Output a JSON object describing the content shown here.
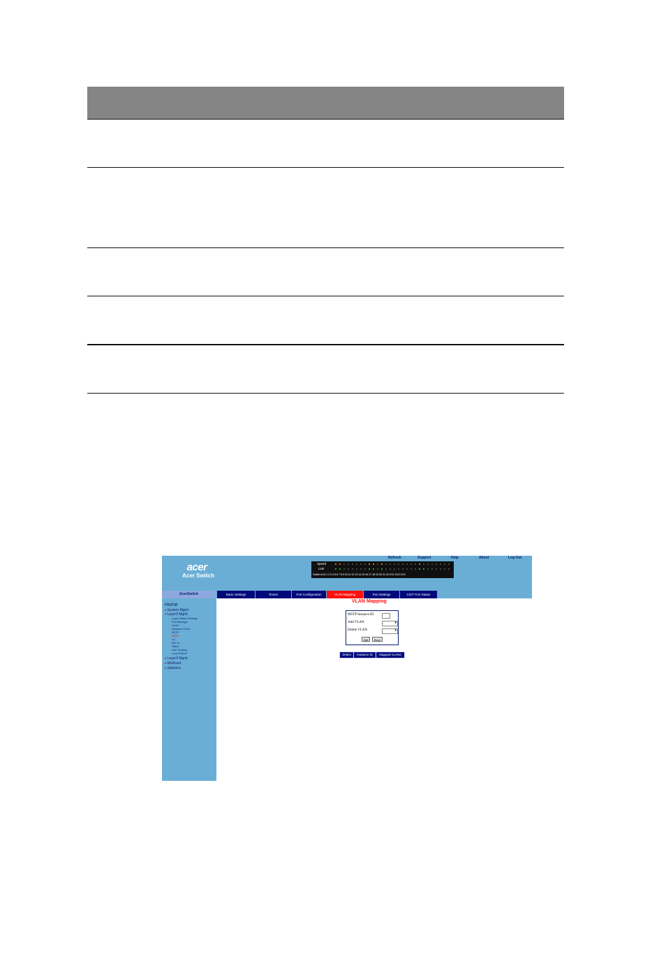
{
  "doc": {
    "separator_count": 6
  },
  "app": {
    "logo": "acer",
    "brand": "Acer Switch",
    "top_links": [
      "Refresh",
      "Support",
      "Help",
      "About",
      "Log Out"
    ],
    "panel": {
      "speed_label": "Speed",
      "link_label": "Link",
      "ports_label": "Switch 8-Gi 1 2 3 4 5 6 7 8 9 10 11 12 13 14 15 16 17 18 19 20 21 22 XX1 XX2 XX3"
    },
    "sidebar_header": "AcerSwitch",
    "tabs": [
      "Basic Settings",
      "Timers",
      "Port Configuration",
      "VLAN Mapping",
      "Port Settings",
      "CIST Port Status"
    ],
    "active_tab": 3,
    "sidebar": {
      "home": "Home",
      "items": [
        "System Mgmt",
        "Layer2 Mgmt"
      ],
      "sub_items": [
        "Layer2 Basic Settings",
        "Port Manager",
        "VLAN",
        "Dynamic VLAN",
        "RSTP",
        "MSTP",
        "LA",
        "802.1x",
        "Filters",
        "Link Tracking",
        "Loop Protect"
      ],
      "current_sub": "MSTP",
      "items_after": [
        "Layer3 Mgmt",
        "Multicast",
        "Statistics"
      ]
    },
    "page_title": "VLAN Mapping",
    "form": {
      "instance_label": "MSTP Instance ID",
      "add_label": "Add VLAN",
      "delete_label": "Delete VLAN",
      "add_value": "-",
      "delete_value": "",
      "apply_button": "Add",
      "reset_button": "Reset"
    },
    "table_headers": [
      "Select",
      "Instance ID",
      "Mapped VLANs"
    ],
    "colors": {
      "banner": "#6aaed6",
      "tab": "#000a7a",
      "active_tab": "#ff1010"
    }
  }
}
